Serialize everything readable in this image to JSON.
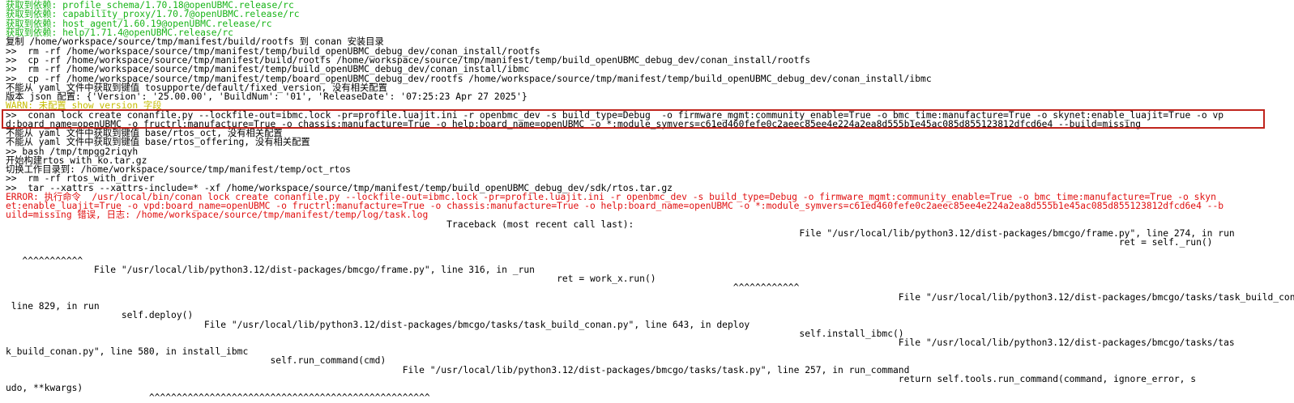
{
  "terminal": {
    "lines": [
      {
        "text": "获取到依赖: profile_schema/1.70.18@openUBMC.release/rc",
        "color": "#18b418"
      },
      {
        "text": "获取到依赖: capability_proxy/1.70.7@openUBMC.release/rc",
        "color": "#18b418"
      },
      {
        "text": "获取到依赖: host_agent/1.60.19@openUBMC.release/rc",
        "color": "#18b418"
      },
      {
        "text": "获取到依赖: help/1.71.4@openUBMC.release/rc",
        "color": "#18b418"
      },
      {
        "text": "复制 /home/workspace/source/tmp/manifest/build/rootfs 到 conan 安装目录",
        "color": "#000000"
      },
      {
        "text": ">>  rm -rf /home/workspace/source/tmp/manifest/temp/build_openUBMC_debug_dev/conan_install/rootfs",
        "color": "#000000"
      },
      {
        "text": ">>  cp -rf /home/workspace/source/tmp/manifest/build/rootfs /home/workspace/source/tmp/manifest/temp/build_openUBMC_debug_dev/conan_install/rootfs",
        "color": "#000000"
      },
      {
        "text": ">>  rm -rf /home/workspace/source/tmp/manifest/temp/build_openUBMC_debug_dev/conan_install/ibmc",
        "color": "#000000"
      },
      {
        "text": ">>  cp -rf /home/workspace/source/tmp/manifest/temp/board_openUBMC_debug_dev/rootfs /home/workspace/source/tmp/manifest/temp/build_openUBMC_debug_dev/conan_install/ibmc",
        "color": "#000000"
      },
      {
        "text": "不能从 yaml 文件中获取到键值 tosupporte/default/fixed_version, 没有相关配置",
        "color": "#000000"
      },
      {
        "text": "版本 json 配置: {'Version': '25.00.00', 'BuildNum': '01', 'ReleaseDate': '07:25:23 Apr 27 2025'}",
        "color": "#000000"
      },
      {
        "text": "WARN: 未配置 show_version 字段",
        "color": "#c6bc00"
      },
      {
        "text": ">>  conan lock create conanfile.py --lockfile-out=ibmc.lock -pr=profile.luajit.ini -r openbmc_dev -s build_type=Debug  -o firmware_mgmt:community_enable=True -o bmc_time:manufacture=True -o skynet:enable_luajit=True -o vp",
        "color": "#000000"
      },
      {
        "text": "d:board_name=openUBMC -o fructrl:manufacture=True -o chassis:manufacture=True -o help:board_name=openUBMC -o *:module_symvers=c61ed460fefe0c2aeec85ee4e224a2ea8d555b1e45ac085d855123812dfcd6e4 --build=missing",
        "color": "#000000"
      },
      {
        "text": "不能从 yaml 文件中获取到键值 base/rtos_oct, 没有相关配置",
        "color": "#000000"
      },
      {
        "text": "不能从 yaml 文件中获取到键值 base/rtos_offering, 没有相关配置",
        "color": "#000000"
      },
      {
        "text": ">> bash /tmp/tmpgg2riqyh",
        "color": "#000000"
      },
      {
        "text": "开始构建rtos_with_ko.tar.gz",
        "color": "#000000"
      },
      {
        "text": "切换工作目录到: /home/workspace/source/tmp/manifest/temp/oct_rtos",
        "color": "#000000"
      },
      {
        "text": ">>  rm -rf rtos_with_driver",
        "color": "#000000"
      },
      {
        "text": ">>  tar --xattrs --xattrs-include=* -xf /home/workspace/source/tmp/manifest/temp/build_openUBMC_debug_dev/sdk/rtos.tar.gz",
        "color": "#000000"
      },
      {
        "text": "ERROR: 执行命令  /usr/local/bin/conan lock create conanfile.py --lockfile-out=ibmc.lock -pr=profile.luajit.ini -r openbmc_dev -s build_type=Debug -o firmware_mgmt:community_enable=True -o bmc_time:manufacture=True -o skyn",
        "color": "#e01010"
      },
      {
        "text": "et:enable_luajit=True -o vpd:board_name=openUBMC -o fructrl:manufacture=True -o chassis:manufacture=True -o help:board_name=openUBMC -o *:module_symvers=c61ed460fefe0c2aeec85ee4e224a2ea8d555b1e45ac085d855123812dfcd6e4 --b",
        "color": "#e01010"
      },
      {
        "text": "uild=missing 错误, 日志: /home/workspace/source/tmp/manifest/temp/log/task.log",
        "color": "#e01010"
      },
      {
        "text": "                                                                                Traceback (most recent call last):",
        "color": "#000000"
      },
      {
        "text": "                                                                                                                                                File \"/usr/local/lib/python3.12/dist-packages/bmcgo/frame.py\", line 274, in run",
        "color": "#000000"
      },
      {
        "text": "                                                                                                                                                                                                          ret = self._run()",
        "color": "#000000"
      },
      {
        "text": "",
        "color": "#000000"
      },
      {
        "text": "   ^^^^^^^^^^^",
        "color": "#000000"
      },
      {
        "text": "                File \"/usr/local/lib/python3.12/dist-packages/bmcgo/frame.py\", line 316, in _run",
        "color": "#000000"
      },
      {
        "text": "                                                                                                    ret = work_x.run()",
        "color": "#000000"
      },
      {
        "text": "                                                                                                                                    ^^^^^^^^^^^^",
        "color": "#000000"
      },
      {
        "text": "                                                                                                                                                                  File \"/usr/local/lib/python3.12/dist-packages/bmcgo/tasks/task_build_conan.py\",",
        "color": "#000000"
      },
      {
        "text": " line 829, in run",
        "color": "#000000"
      },
      {
        "text": "                     self.deploy()",
        "color": "#000000"
      },
      {
        "text": "                                    File \"/usr/local/lib/python3.12/dist-packages/bmcgo/tasks/task_build_conan.py\", line 643, in deploy",
        "color": "#000000"
      },
      {
        "text": "                                                                                                                                                self.install_ibmc()",
        "color": "#000000"
      },
      {
        "text": "                                                                                                                                                                  File \"/usr/local/lib/python3.12/dist-packages/bmcgo/tasks/tas",
        "color": "#000000"
      },
      {
        "text": "k_build_conan.py\", line 580, in install_ibmc",
        "color": "#000000"
      },
      {
        "text": "                                                self.run_command(cmd)",
        "color": "#000000"
      },
      {
        "text": "                                                                        File \"/usr/local/lib/python3.12/dist-packages/bmcgo/tasks/task.py\", line 257, in run_command",
        "color": "#000000"
      },
      {
        "text": "                                                                                                                                                                  return self.tools.run_command(command, ignore_error, s",
        "color": "#000000"
      },
      {
        "text": "udo, **kwargs)",
        "color": "#000000"
      },
      {
        "text": "                          ^^^^^^^^^^^^^^^^^^^^^^^^^^^^^^^^^^^^^^^^^^^^^^^^^^^",
        "color": "#000000"
      }
    ]
  }
}
